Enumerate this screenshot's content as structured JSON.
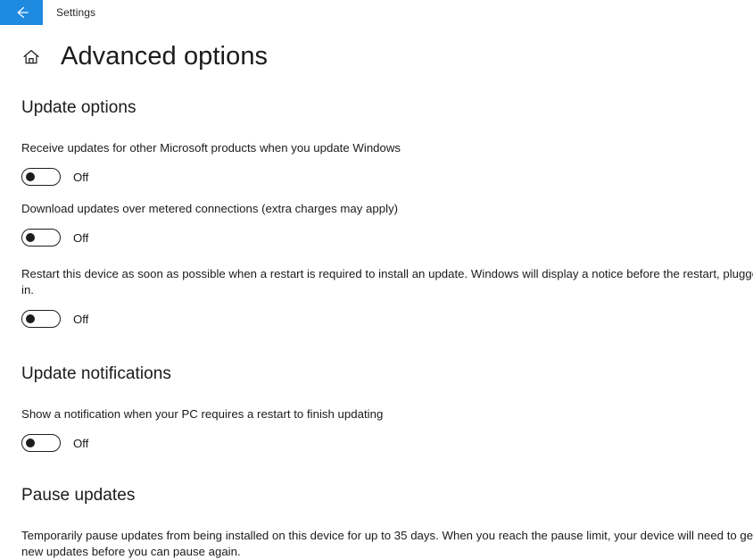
{
  "window": {
    "app_title": "Settings",
    "back_icon": "arrow-left-icon",
    "accent_color": "#1e8ae0"
  },
  "header": {
    "home_icon": "home-icon",
    "title": "Advanced options"
  },
  "sections": {
    "update_options": {
      "heading": "Update options",
      "settings": [
        {
          "description": "Receive updates for other Microsoft products when you update Windows",
          "toggle_state": "Off"
        },
        {
          "description": "Download updates over metered connections (extra charges may apply)",
          "toggle_state": "Off"
        },
        {
          "description": "Restart this device as soon as possible when a restart is required to install an update. Windows will display a notice before the restart, plugged in.",
          "toggle_state": "Off"
        }
      ]
    },
    "update_notifications": {
      "heading": "Update notifications",
      "settings": [
        {
          "description": "Show a notification when your PC requires a restart to finish updating",
          "toggle_state": "Off"
        }
      ]
    },
    "pause_updates": {
      "heading": "Pause updates",
      "description": "Temporarily pause updates from being installed on this device for up to 35 days. When you reach the pause limit, your device will need to get new updates before you can pause again."
    }
  }
}
